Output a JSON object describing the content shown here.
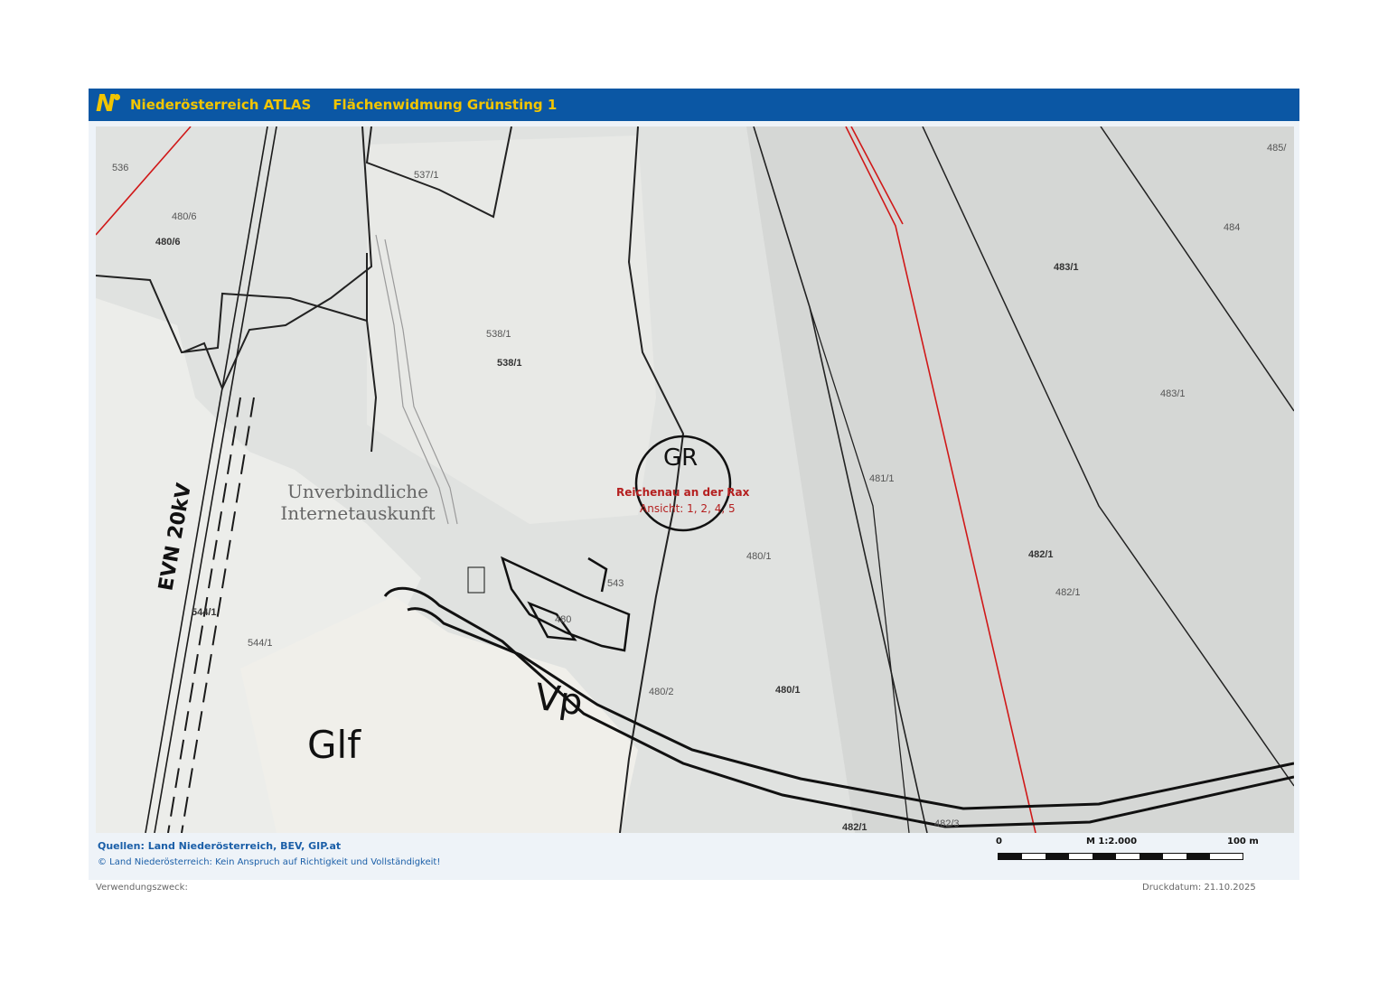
{
  "header": {
    "app_title": "Niederösterreich ATLAS",
    "map_title": "Flächenwidmung Grünsting 1"
  },
  "map": {
    "parcels": [
      "536",
      "537/1",
      "480/6",
      "480/6",
      "538/1",
      "538/1",
      "485/",
      "484",
      "483/1",
      "483/1",
      "481/1",
      "482/1",
      "482/1",
      "480/1",
      "480/1",
      "544/1",
      "544/1",
      "543",
      "480/2",
      "482/3",
      "482/1",
      "480"
    ],
    "zones": [
      "Glf",
      "Vp",
      "GR"
    ],
    "line_label": "EVN 20kV",
    "watermark": [
      "Unverbindliche",
      "Internetauskunft"
    ],
    "place_name": "Reichenau an der Rax",
    "views": "Ansicht: 1, 2, 4, 5"
  },
  "footer": {
    "sources": "Quellen: Land Niederösterreich, BEV, GIP.at",
    "copyright": "© Land Niederösterreich: Kein Anspruch auf Richtigkeit und Vollständigkeit!",
    "scale_start": "0",
    "scale_ratio": "M 1:2.000",
    "scale_end": "100 m",
    "purpose_label": "Verwendungszweck:",
    "print_date": "Druckdatum: 21.10.2025"
  }
}
